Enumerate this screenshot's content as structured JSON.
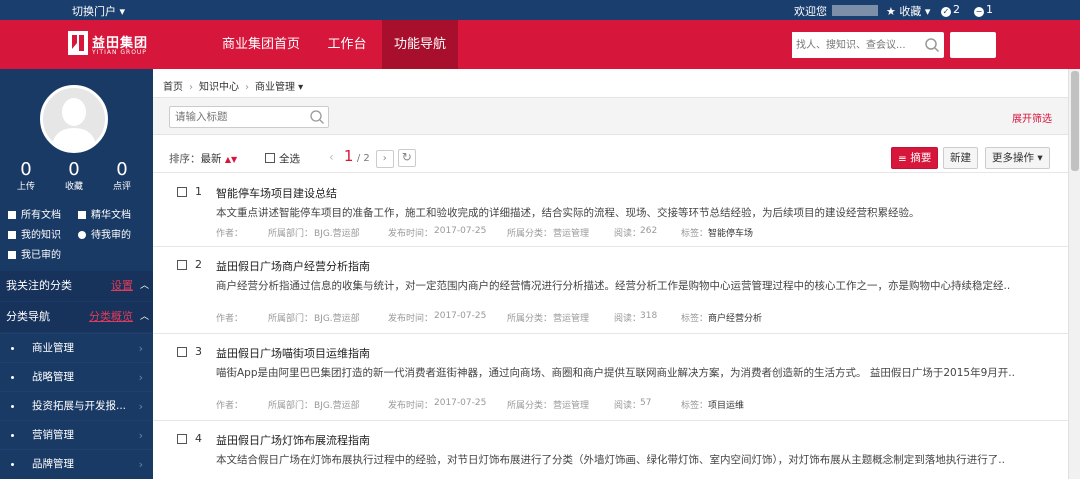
{
  "topbar": {
    "portal_switch": "切换门户 ▾",
    "welcome": "欢迎您",
    "favorites": "★ 收藏 ▾",
    "notice_count": "2",
    "message_count": "1"
  },
  "header": {
    "logo_cn": "益田集团",
    "logo_en": "YITIAN GROUP",
    "nav": [
      "商业集团首页",
      "工作台",
      "功能导航"
    ],
    "active_nav": "功能导航",
    "search_placeholder": "找人、搜知识、查会议...",
    "brand_color": "#d6163b"
  },
  "sidebar": {
    "stats": [
      {
        "num": "0",
        "label": "上传"
      },
      {
        "num": "0",
        "label": "收藏"
      },
      {
        "num": "0",
        "label": "点评"
      }
    ],
    "quick_links": [
      "所有文档",
      "精华文档",
      "我的知识",
      "待我审的",
      "我已审的"
    ],
    "followed": {
      "title": "我关注的分类",
      "link": "设置"
    },
    "category_nav": {
      "title": "分类导航",
      "link": "分类概览"
    },
    "categories": [
      "商业管理",
      "战略管理",
      "投资拓展与开发报...",
      "营销管理",
      "品牌管理"
    ]
  },
  "main": {
    "breadcrumb": [
      "首页",
      "知识中心",
      "商业管理 ▾"
    ],
    "title_placeholder": "请输入标题",
    "expand_filter": "展开筛选",
    "sort_label": "排序：",
    "sort_value": "最新",
    "select_all": "全选",
    "page_current": "1",
    "page_total": "/ 2",
    "btn_summary": "摘要",
    "btn_new": "新建",
    "btn_more": "更多操作 ▾",
    "meta_labels": {
      "author": "作者：",
      "dept": "所属部门：",
      "time": "发布时间：",
      "category": "所属分类：",
      "reads": "阅读：",
      "tags": "标签："
    },
    "items": [
      {
        "index": "1",
        "title": "智能停车场项目建设总结",
        "desc": "本文重点讲述智能停车项目的准备工作，施工和验收完成的详细描述，结合实际的流程、现场、交接等环节总结经验，为后续项目的建设经营积累经验。",
        "dept": "BJG.营运部",
        "time": "2017-07-25",
        "category": "营运管理",
        "reads": "262",
        "tags": "智能停车场"
      },
      {
        "index": "2",
        "title": "益田假日广场商户经营分析指南",
        "desc": "商户经营分析指通过信息的收集与统计，对一定范围内商户的经营情况进行分析描述。经营分析工作是购物中心运营管理过程中的核心工作之一，亦是购物中心持续稳定经..",
        "dept": "BJG.营运部",
        "time": "2017-07-25",
        "category": "营运管理",
        "reads": "318",
        "tags": "商户经营分析"
      },
      {
        "index": "3",
        "title": "益田假日广场喵街项目运维指南",
        "desc": "喵街App是由阿里巴巴集团打造的新一代消费者逛街神器，通过向商场、商圈和商户提供互联网商业解决方案，为消费者创造新的生活方式。 益田假日广场于2015年9月开..",
        "dept": "BJG.营运部",
        "time": "2017-07-25",
        "category": "营运管理",
        "reads": "57",
        "tags": "项目运维"
      },
      {
        "index": "4",
        "title": "益田假日广场灯饰布展流程指南",
        "desc": "本文结合假日广场在灯饰布展执行过程中的经验，对节日灯饰布展进行了分类（外墙灯饰画、绿化带灯饰、室内空间灯饰），对灯饰布展从主题概念制定到落地执行进行了..",
        "dept": "",
        "time": "",
        "category": "",
        "reads": "",
        "tags": ""
      }
    ]
  }
}
